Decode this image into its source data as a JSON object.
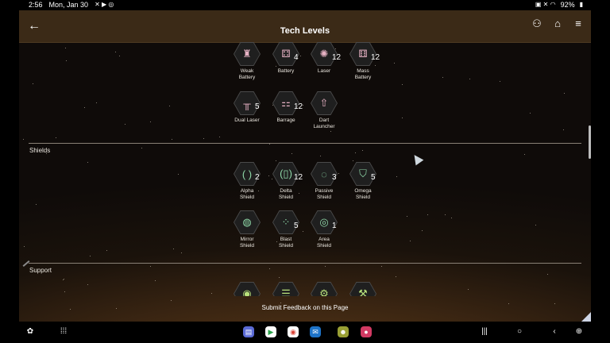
{
  "status_bar": {
    "time": "2:56",
    "date": "Mon, Jan 30",
    "battery": "92%"
  },
  "app_bar": {
    "title": "Tech Levels"
  },
  "weapons_rows": [
    [
      {
        "name": "Weak\nBattery",
        "count": "",
        "icon": "weak-battery-icon"
      },
      {
        "name": "Battery",
        "count": "4",
        "icon": "battery-icon"
      },
      {
        "name": "Laser",
        "count": "12",
        "icon": "laser-icon"
      },
      {
        "name": "Mass\nBattery",
        "count": "12",
        "icon": "mass-battery-icon"
      }
    ],
    [
      {
        "name": "Dual Laser",
        "count": "5",
        "icon": "dual-laser-icon"
      },
      {
        "name": "Barrage",
        "count": "12",
        "icon": "barrage-icon"
      },
      {
        "name": "Dart\nLauncher",
        "count": "",
        "icon": "dart-launcher-icon"
      }
    ]
  ],
  "shields_section": {
    "title": "Shields",
    "rows": [
      [
        {
          "name": "Alpha\nShield",
          "count": "2",
          "icon": "alpha-shield-icon"
        },
        {
          "name": "Delta\nShield",
          "count": "12",
          "icon": "delta-shield-icon"
        },
        {
          "name": "Passive\nShield",
          "count": "3",
          "icon": "passive-shield-icon"
        },
        {
          "name": "Omega\nShield",
          "count": "5",
          "icon": "omega-shield-icon"
        }
      ],
      [
        {
          "name": "Mirror\nShield",
          "count": "",
          "icon": "mirror-shield-icon"
        },
        {
          "name": "Blast\nShield",
          "count": "5",
          "icon": "blast-shield-icon"
        },
        {
          "name": "Area\nShield",
          "count": "1",
          "icon": "area-shield-icon"
        }
      ]
    ]
  },
  "support_section": {
    "title": "Support"
  },
  "feedback": {
    "label": "Submit Feedback on this Page"
  }
}
